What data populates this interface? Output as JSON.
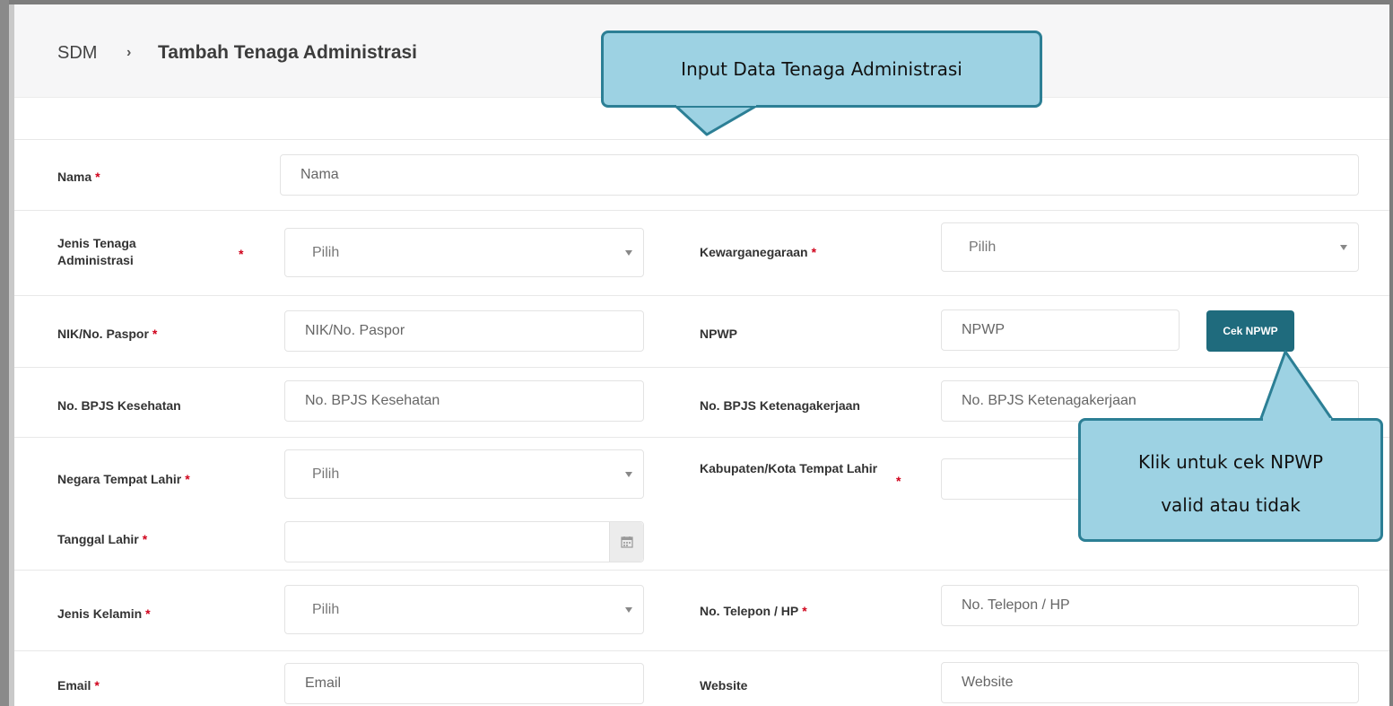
{
  "breadcrumb": {
    "root": "SDM",
    "separator": "›",
    "current": "Tambah Tenaga Administrasi"
  },
  "form": {
    "nama": {
      "label": "Nama",
      "placeholder": "Nama"
    },
    "jenis_tenaga": {
      "label": "Jenis Tenaga Administrasi",
      "value": "Pilih"
    },
    "kewarganegaraan": {
      "label": "Kewarganegaraan",
      "value": "Pilih"
    },
    "nik": {
      "label": "NIK/No. Paspor",
      "placeholder": "NIK/No. Paspor"
    },
    "npwp": {
      "label": "NPWP",
      "placeholder": "NPWP",
      "button": "Cek NPWP"
    },
    "bpjs_kesehatan": {
      "label": "No. BPJS Kesehatan",
      "placeholder": "No. BPJS Kesehatan"
    },
    "bpjs_ketenagakerjaan": {
      "label": "No. BPJS Ketenagakerjaan",
      "placeholder": "No. BPJS Ketenagakerjaan"
    },
    "negara_lahir": {
      "label": "Negara Tempat Lahir",
      "value": "Pilih"
    },
    "kota_lahir": {
      "label": "Kabupaten/Kota Tempat Lahir",
      "value": ""
    },
    "tanggal_lahir": {
      "label": "Tanggal Lahir",
      "value": ""
    },
    "jenis_kelamin": {
      "label": "Jenis Kelamin",
      "value": "Pilih"
    },
    "telepon": {
      "label": "No. Telepon / HP",
      "placeholder": "No. Telepon / HP"
    },
    "email": {
      "label": "Email",
      "placeholder": "Email"
    },
    "website": {
      "label": "Website",
      "placeholder": "Website"
    },
    "required_mark": "*"
  },
  "callouts": {
    "top": "Input Data Tenaga Administrasi",
    "right_line1": "Klik untuk cek NPWP",
    "right_line2": "valid atau tidak"
  },
  "colors": {
    "button": "#1f6b7d",
    "callout_fill": "#9dd2e3",
    "callout_border": "#2c7f95",
    "required": "#d0021b"
  }
}
